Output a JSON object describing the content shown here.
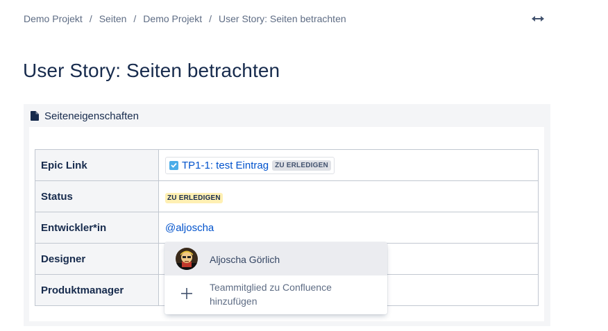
{
  "breadcrumb": {
    "items": [
      "Demo Projekt",
      "Seiten",
      "Demo Projekt",
      "User Story: Seiten betrachten"
    ],
    "separator": "/"
  },
  "header": {
    "expand_icon": "expand-width-icon"
  },
  "page": {
    "title": "User Story: Seiten betrachten"
  },
  "panel": {
    "title": "Seiteneigenschaften",
    "icon": "document-icon",
    "rows": [
      {
        "key": "Epic Link",
        "issue_key_text": "TP1-1: test Eintrag",
        "status": "ZU ERLEDIGEN"
      },
      {
        "key": "Status",
        "status": "ZU ERLEDIGEN"
      },
      {
        "key": "Entwickler*in",
        "mention": "@aljoscha"
      },
      {
        "key": "Designer"
      },
      {
        "key": "Produktmanager"
      }
    ]
  },
  "dropdown": {
    "user_name": "Aljoscha Görlich",
    "add_label": "Teammitglied zu Confluence hinzufügen"
  },
  "colors": {
    "link": "#0052cc",
    "lozenge_yellow_bg": "#fff0b3",
    "lozenge_grey_bg": "#dfe1e6",
    "panel_bg": "#f4f5f7",
    "text": "#172b4d"
  }
}
